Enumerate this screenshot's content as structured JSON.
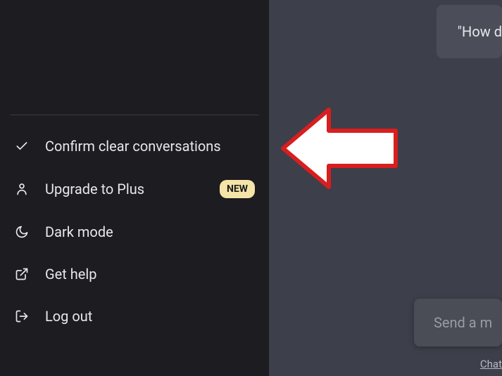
{
  "sidebar": {
    "items": [
      {
        "label": "Confirm clear conversations",
        "icon": "check",
        "badge": null
      },
      {
        "label": "Upgrade to Plus",
        "icon": "person",
        "badge": "NEW"
      },
      {
        "label": "Dark mode",
        "icon": "moon",
        "badge": null
      },
      {
        "label": "Get help",
        "icon": "external",
        "badge": null
      },
      {
        "label": "Log out",
        "icon": "logout",
        "badge": null
      }
    ]
  },
  "main": {
    "example_text": "\"How d",
    "input_placeholder": "Send a m",
    "footer": "Chat"
  }
}
